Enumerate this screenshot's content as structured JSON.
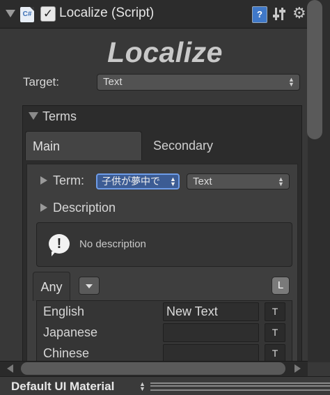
{
  "header": {
    "title": "Localize (Script)",
    "enabled": true,
    "script_icon_text": "C#",
    "help_icon_text": "?",
    "icons": [
      "fold-triangle-icon",
      "csharp-script-icon",
      "help-icon",
      "preset-icon",
      "gear-icon"
    ]
  },
  "component_title": "Localize",
  "target": {
    "label": "Target:",
    "value": "Text"
  },
  "terms": {
    "label": "Terms",
    "tabs": [
      {
        "label": "Main",
        "selected": true
      },
      {
        "label": "Secondary",
        "selected": false
      }
    ],
    "term": {
      "label": "Term:",
      "value": "子供が夢中で",
      "type_value": "Text"
    },
    "description": {
      "label": "Description",
      "text": "No description"
    },
    "language_tab": {
      "label": "Any",
      "l_button": "L"
    },
    "languages": [
      {
        "name": "English",
        "value": "New Text",
        "t_label": "T"
      },
      {
        "name": "Japanese",
        "value": "",
        "t_label": "T"
      },
      {
        "name": "Chinese",
        "value": "",
        "t_label": "T"
      }
    ]
  },
  "footer": {
    "material": "Default UI Material"
  },
  "colors": {
    "background": "#383838",
    "header": "#2c2c2c",
    "selected_field": "#3c5c94",
    "selected_border": "#6e9ce8"
  }
}
